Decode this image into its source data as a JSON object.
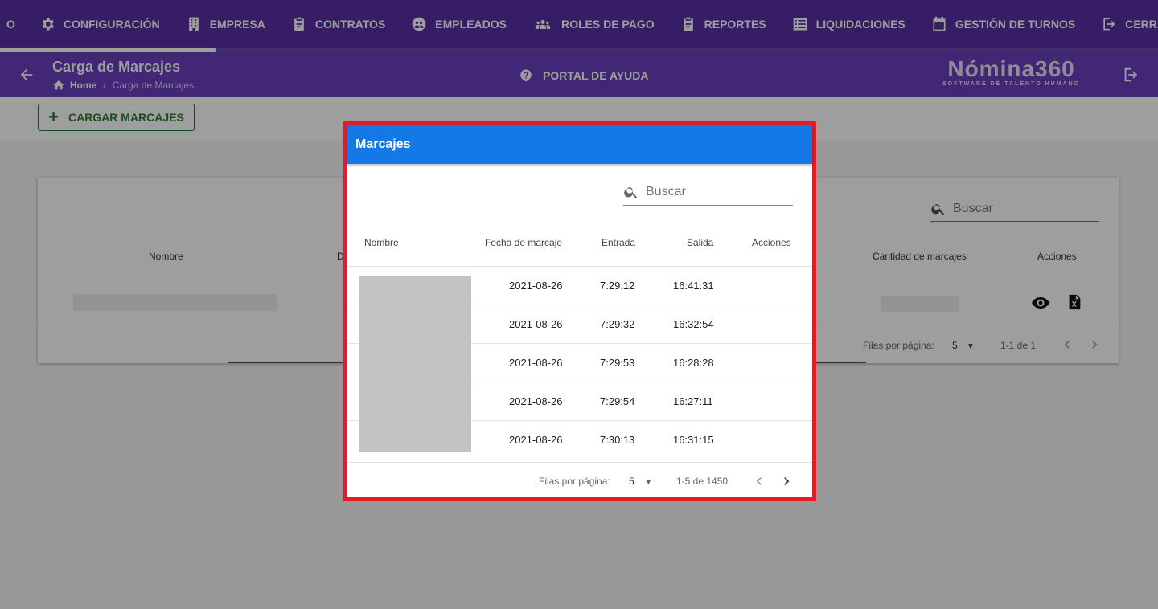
{
  "nav": {
    "items": [
      {
        "label": "CONFIGURACIÓN",
        "icon": "gear-icon"
      },
      {
        "label": "EMPRESA",
        "icon": "building-icon"
      },
      {
        "label": "CONTRATOS",
        "icon": "clipboard-icon"
      },
      {
        "label": "EMPLEADOS",
        "icon": "users-circle-icon"
      },
      {
        "label": "ROLES DE PAGO",
        "icon": "users-group-icon"
      },
      {
        "label": "REPORTES",
        "icon": "report-icon"
      },
      {
        "label": "LIQUIDACIONES",
        "icon": "list-icon"
      },
      {
        "label": "GESTIÓN DE TURNOS",
        "icon": "calendar-icon"
      },
      {
        "label": "CERRAR SESIÓ",
        "icon": "logout-icon"
      }
    ],
    "truncated_left": "O"
  },
  "header": {
    "title": "Carga de Marcajes",
    "breadcrumb_home": "Home",
    "breadcrumb_sep": "/",
    "breadcrumb_current": "Carga de Marcajes",
    "help_label": "PORTAL DE AYUDA",
    "logo_text": "Nómina360",
    "logo_tagline": "SOFTWARE DE TALENTO HUMANO"
  },
  "toolbar": {
    "cargar_label": "CARGAR MARCAJES"
  },
  "background_table": {
    "search_placeholder": "Buscar",
    "col_nombre": "Nombre",
    "col_partial": "D",
    "col_cantidad": "Cantidad de marcajes",
    "col_acciones": "Acciones",
    "rows_per_page_label": "Filas por página:",
    "rows_per_page_value": "5",
    "range": "1-1 de 1"
  },
  "dialog": {
    "title": "Marcajes",
    "search_placeholder": "Buscar",
    "columns": [
      "Nombre",
      "Fecha de marcaje",
      "Entrada",
      "Salida",
      "Acciones"
    ],
    "rows": [
      {
        "fecha": "2021-08-26",
        "entrada": "7:29:12",
        "salida": "16:41:31"
      },
      {
        "fecha": "2021-08-26",
        "entrada": "7:29:32",
        "salida": "16:32:54"
      },
      {
        "fecha": "2021-08-26",
        "entrada": "7:29:53",
        "salida": "16:28:28"
      },
      {
        "fecha": "2021-08-26",
        "entrada": "7:29:54",
        "salida": "16:27:11"
      },
      {
        "fecha": "2021-08-26",
        "entrada": "7:30:13",
        "salida": "16:31:15"
      }
    ],
    "rows_per_page_label": "Filas por página:",
    "rows_per_page_value": "5",
    "range": "1-5 de 1450"
  },
  "colors": {
    "nav_bg": "#5a2fa5",
    "header_bg": "#6a3fbf",
    "dialog_header": "#1479e6",
    "highlight_border": "#e01c24",
    "success": "#2e7d32"
  }
}
